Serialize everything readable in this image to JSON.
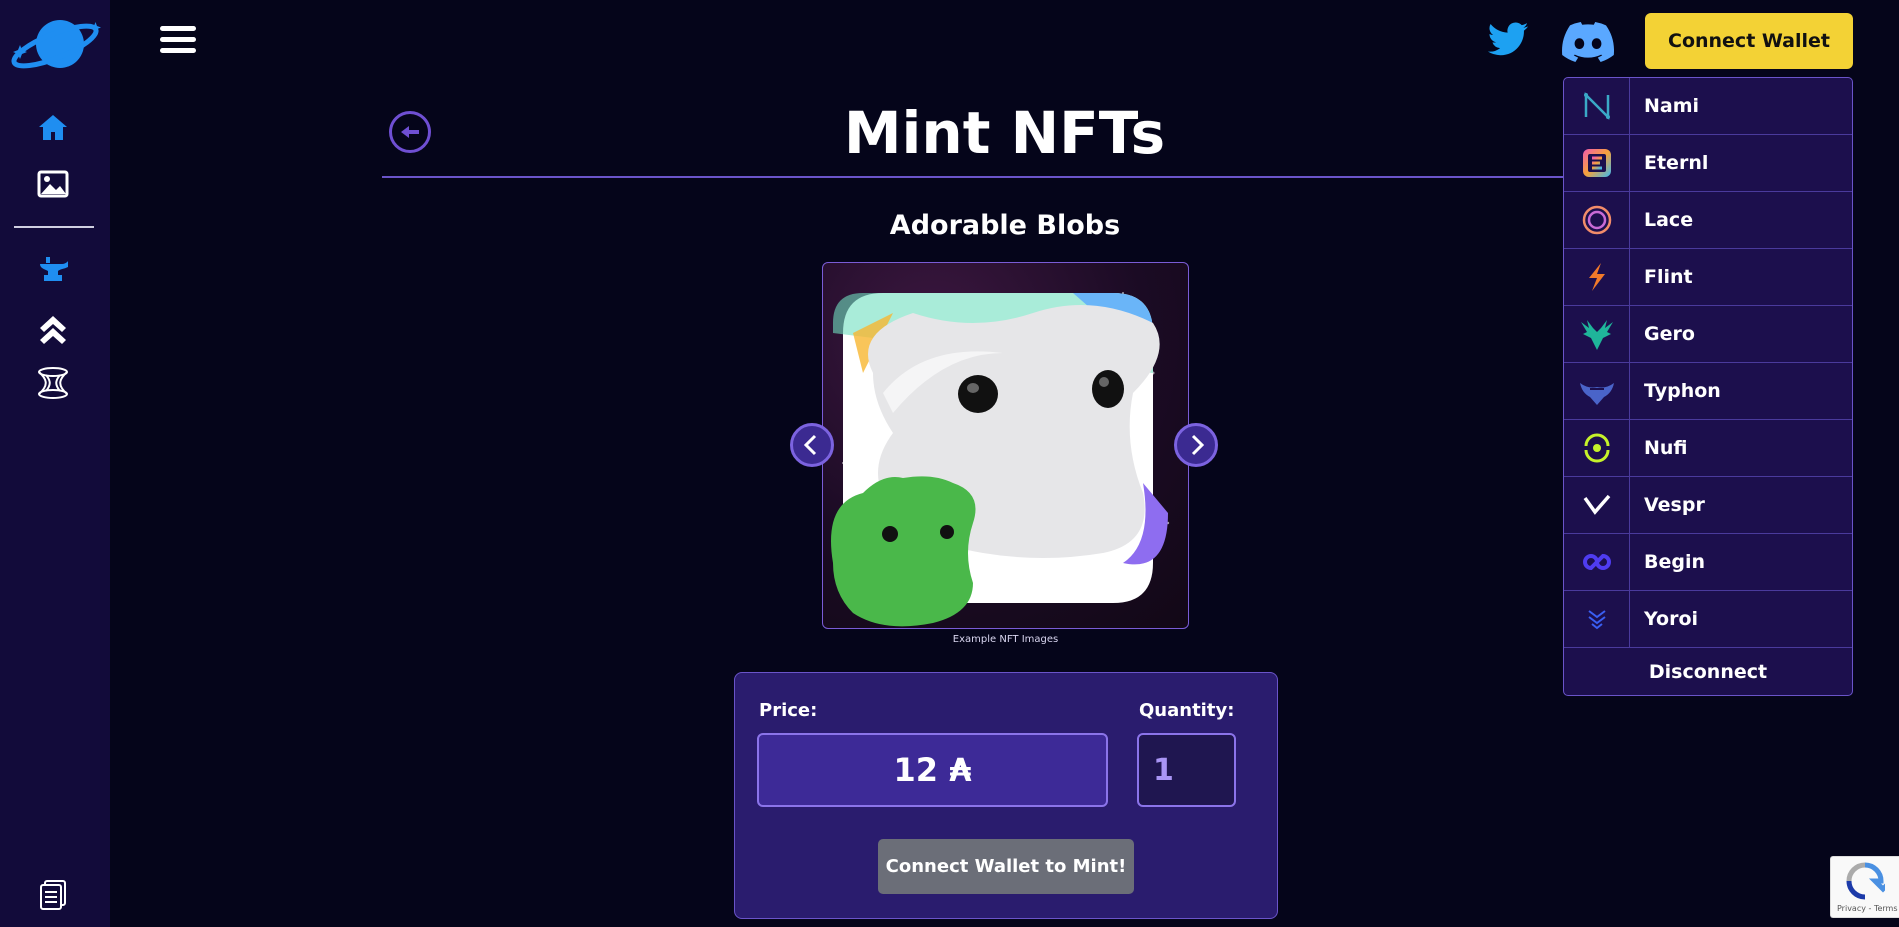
{
  "colors": {
    "background": "#05051a",
    "sidebar": "#120b3a",
    "accent": "#6a54c9",
    "connect_button": "#f3d235",
    "panel": "#2a1c6e",
    "mint_button_disabled": "#6b6e78"
  },
  "header": {
    "connect_label": "Connect Wallet",
    "icons": [
      "menu-icon",
      "twitter-icon",
      "discord-icon"
    ]
  },
  "sidebar": {
    "items": [
      {
        "icon": "home-icon"
      },
      {
        "icon": "image-icon"
      },
      {
        "icon": "anvil-icon"
      },
      {
        "icon": "double-chevron-up-icon"
      },
      {
        "icon": "wormhole-icon"
      },
      {
        "icon": "docs-icon"
      }
    ]
  },
  "main": {
    "title": "Mint NFTs",
    "collection": "Adorable Blobs",
    "caption": "Example NFT Images",
    "price_label": "Price:",
    "price_value": "12 ₳",
    "quantity_label": "Quantity:",
    "quantity_value": "1",
    "mint_button": "Connect Wallet to Mint!"
  },
  "wallet_menu": {
    "items": [
      {
        "name": "Nami",
        "icon": "nami-icon"
      },
      {
        "name": "Eternl",
        "icon": "eternl-icon"
      },
      {
        "name": "Lace",
        "icon": "lace-icon"
      },
      {
        "name": "Flint",
        "icon": "flint-icon"
      },
      {
        "name": "Gero",
        "icon": "gero-icon"
      },
      {
        "name": "Typhon",
        "icon": "typhon-icon"
      },
      {
        "name": "Nufi",
        "icon": "nufi-icon"
      },
      {
        "name": "Vespr",
        "icon": "vespr-icon"
      },
      {
        "name": "Begin",
        "icon": "begin-icon"
      },
      {
        "name": "Yoroi",
        "icon": "yoroi-icon"
      }
    ],
    "disconnect_label": "Disconnect"
  },
  "recaptcha": {
    "text": "Privacy - Terms"
  }
}
